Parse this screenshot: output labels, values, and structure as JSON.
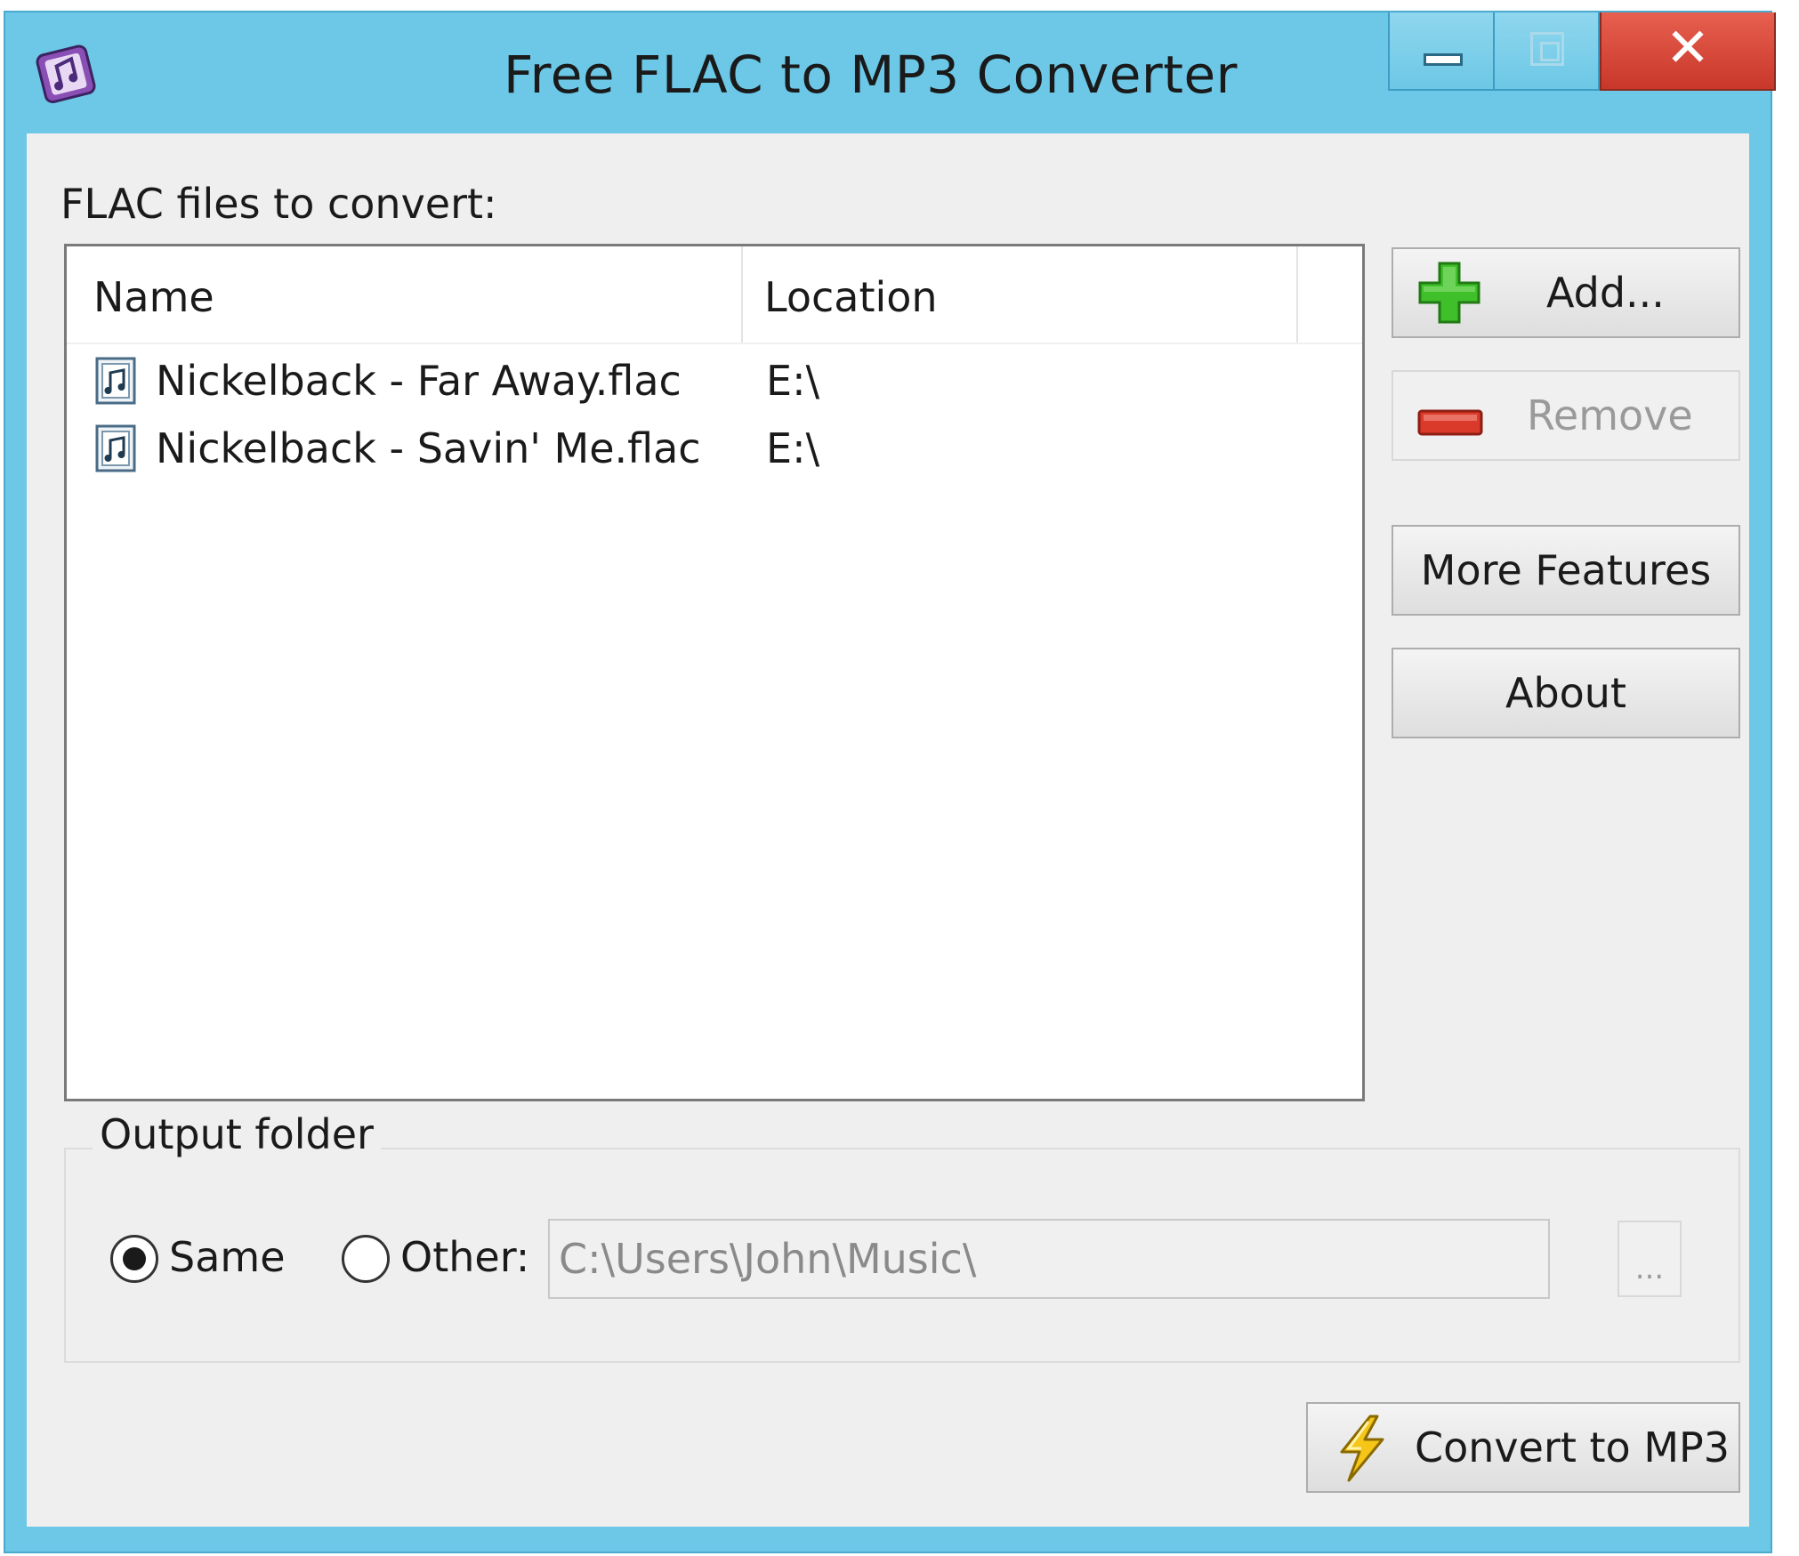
{
  "window": {
    "title": "Free FLAC to MP3 Converter",
    "controls": {
      "minimize": "minimize",
      "maximize": "maximize",
      "close": "✕"
    }
  },
  "files_section": {
    "label": "FLAC files to convert:",
    "columns": [
      "Name",
      "Location"
    ],
    "rows": [
      {
        "name": "Nickelback - Far Away.flac",
        "location": "E:\\",
        "icon": "audio-file-icon"
      },
      {
        "name": "Nickelback - Savin' Me.flac",
        "location": "E:\\",
        "icon": "audio-file-icon"
      }
    ]
  },
  "buttons": {
    "add": "Add...",
    "remove": "Remove",
    "more_features": "More Features",
    "about": "About",
    "convert": "Convert to MP3",
    "browse": "..."
  },
  "output": {
    "group_label": "Output folder",
    "same_label": "Same",
    "other_label": "Other:",
    "selected": "same",
    "path": "C:\\Users\\John\\Music\\"
  },
  "colors": {
    "titlebar": "#6cc8e6",
    "close_button": "#d9473a",
    "add_icon": "#3fbf2a",
    "remove_icon": "#d93a2a",
    "convert_icon": "#f0c020"
  },
  "icons": {
    "app": "app-music-icon",
    "add": "green-plus-icon",
    "remove": "red-minus-icon",
    "convert": "lightning-bolt-icon"
  }
}
